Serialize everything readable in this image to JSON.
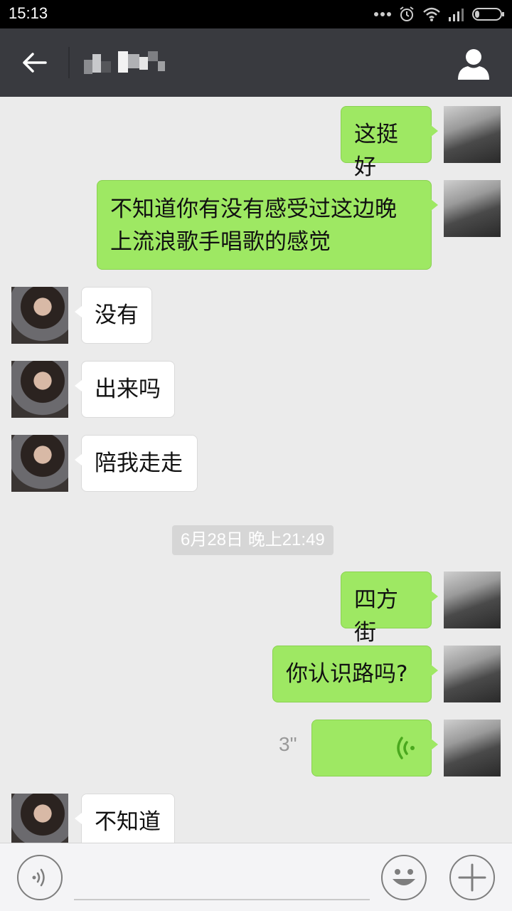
{
  "status_bar": {
    "time": "15:13"
  },
  "header": {
    "contact_name": "",
    "back_icon": "back-arrow-icon",
    "profile_icon": "person-icon"
  },
  "messages": [
    {
      "side": "me",
      "text": "这挺好"
    },
    {
      "side": "me",
      "text": "不知道你有没有感受过这边晚上流浪歌手唱歌的感觉"
    },
    {
      "side": "her",
      "text": "没有"
    },
    {
      "side": "her",
      "text": "出来吗"
    },
    {
      "side": "her",
      "text": "陪我走走"
    },
    {
      "side": "timestamp",
      "text": "6月28日 晚上21:49"
    },
    {
      "side": "me",
      "text": "四方街"
    },
    {
      "side": "me",
      "text": "你认识路吗?"
    },
    {
      "side": "me",
      "type": "voice",
      "duration": "3\""
    },
    {
      "side": "her",
      "text": "不知道"
    }
  ],
  "input_bar": {
    "voice_icon": "voice-mode-icon",
    "emoji_icon": "emoji-icon",
    "plus_icon": "plus-icon"
  },
  "colors": {
    "header_bg": "#393a3f",
    "chat_bg": "#ebebeb",
    "my_bubble": "#9ee863",
    "their_bubble": "#ffffff"
  }
}
